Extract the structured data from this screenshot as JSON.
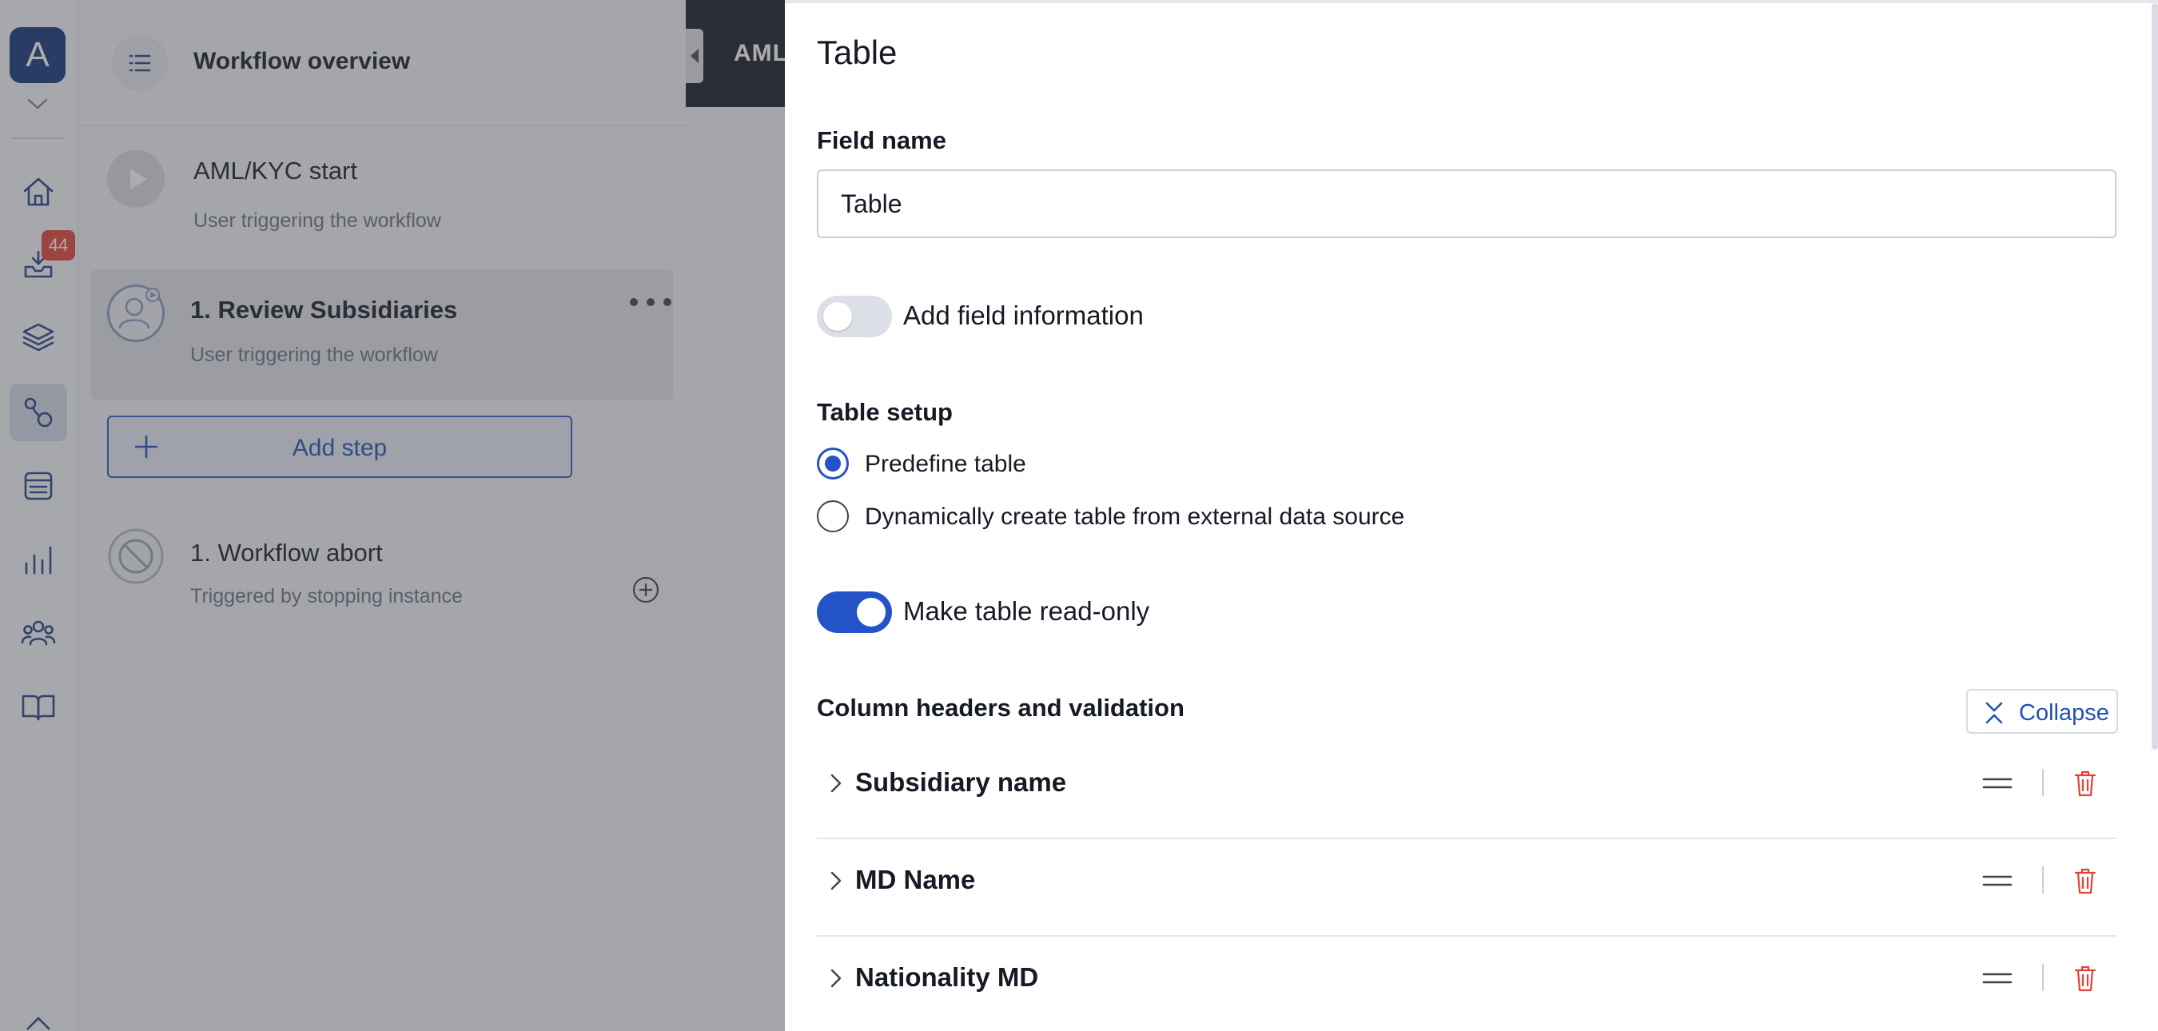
{
  "rail": {
    "logo_letter": "A",
    "inbox_badge": "44",
    "items": [
      {
        "icon": "home-icon"
      },
      {
        "icon": "inbox-icon"
      },
      {
        "icon": "layers-icon"
      },
      {
        "icon": "workflow-icon",
        "active": true
      },
      {
        "icon": "list-icon"
      },
      {
        "icon": "bar-chart-icon"
      },
      {
        "icon": "users-icon"
      },
      {
        "icon": "book-icon"
      }
    ]
  },
  "workflow": {
    "title": "Workflow overview",
    "steps": [
      {
        "name": "AML/KYC start",
        "sub": "User triggering the workflow"
      },
      {
        "name": "1. Review Subsidiaries",
        "sub": "User triggering the workflow"
      }
    ],
    "add_step_label": "Add step",
    "abort": {
      "name": "1. Workflow abort",
      "sub": "Triggered by stopping instance"
    }
  },
  "topbar": {
    "crumb": "AML/"
  },
  "panel": {
    "title": "Table",
    "field_name_label": "Field name",
    "field_name_value": "Table",
    "add_info_label": "Add field information",
    "add_info_on": false,
    "table_setup_label": "Table setup",
    "radio_options": [
      {
        "label": "Predefine table",
        "checked": true
      },
      {
        "label": "Dynamically create table from external data source",
        "checked": false
      }
    ],
    "read_only_label": "Make table read-only",
    "read_only_on": true,
    "columns_label": "Column headers and validation",
    "collapse_label": "Collapse",
    "columns": [
      {
        "name": "Subsidiary name"
      },
      {
        "name": "MD Name"
      },
      {
        "name": "Nationality MD"
      }
    ]
  },
  "colors": {
    "accent": "#2453c8",
    "brand_dark": "#123377",
    "danger": "#e1433a",
    "topbar": "#141a26"
  }
}
